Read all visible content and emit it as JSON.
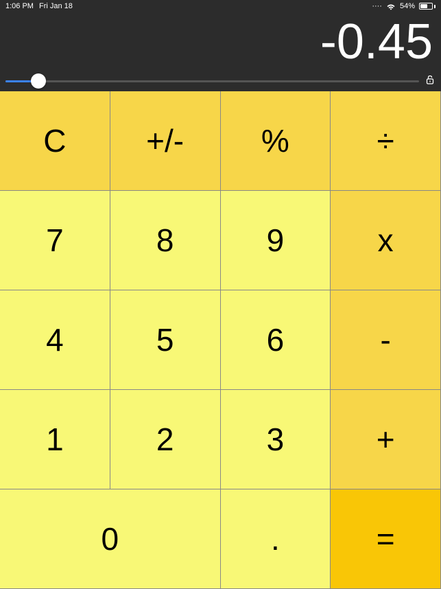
{
  "status": {
    "time": "1:06 PM",
    "date": "Fri Jan 18",
    "battery_pct": "54%"
  },
  "display": {
    "value": "-0.45"
  },
  "keys": {
    "clear": "C",
    "sign": "+/-",
    "percent": "%",
    "divide": "÷",
    "n7": "7",
    "n8": "8",
    "n9": "9",
    "multiply": "x",
    "n4": "4",
    "n5": "5",
    "n6": "6",
    "subtract": "-",
    "n1": "1",
    "n2": "2",
    "n3": "3",
    "add": "+",
    "n0": "0",
    "decimal": ".",
    "equals": "="
  }
}
